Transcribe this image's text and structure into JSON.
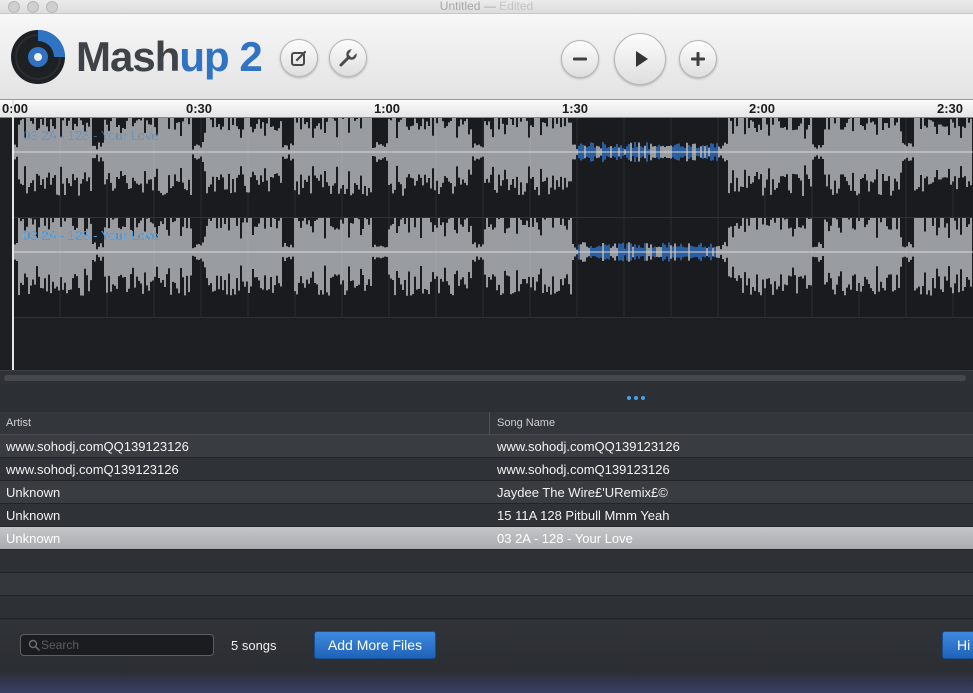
{
  "window": {
    "title": "Untitled",
    "separator": "—",
    "status": "Edited"
  },
  "app": {
    "logo_part1": "Mash",
    "logo_part2": "up",
    "logo_part3": " 2"
  },
  "toolbar": {
    "edit_icon": "edit-square-icon",
    "tools_icon": "wrench-icon",
    "zoom_out_icon": "minus-icon",
    "play_icon": "play-icon",
    "zoom_in_icon": "plus-icon"
  },
  "timeline": {
    "ticks": [
      "0:00",
      "0:30",
      "1:00",
      "1:30",
      "2:00",
      "2:30"
    ]
  },
  "tracks": [
    {
      "label": "03 2A - 128 - Your Love"
    },
    {
      "label": "03 2A - 128 - Your Love"
    }
  ],
  "table": {
    "columns": {
      "artist": "Artist",
      "song": "Song Name"
    },
    "rows": [
      {
        "artist": "www.sohodj.comQQ139123126",
        "song": "www.sohodj.comQQ139123126"
      },
      {
        "artist": "www.sohodj.comQ139123126",
        "song": "www.sohodj.comQ139123126"
      },
      {
        "artist": "Unknown",
        "song": "Jaydee The Wire£'URemix£©"
      },
      {
        "artist": "Unknown",
        "song": "15 11A 128 Pitbull Mmm Yeah"
      },
      {
        "artist": "Unknown",
        "song": "03 2A - 128 - Your Love"
      }
    ],
    "selected_index": 4
  },
  "bottom": {
    "search_placeholder": "Search",
    "song_count": "5 songs",
    "add_files_label": "Add More Files",
    "hide_label": "Hi"
  },
  "colors": {
    "accent": "#2f73c2",
    "waveform": "#b9bcc0",
    "highlight": "#2f6fbf",
    "track_label": "#4aa0e8"
  }
}
